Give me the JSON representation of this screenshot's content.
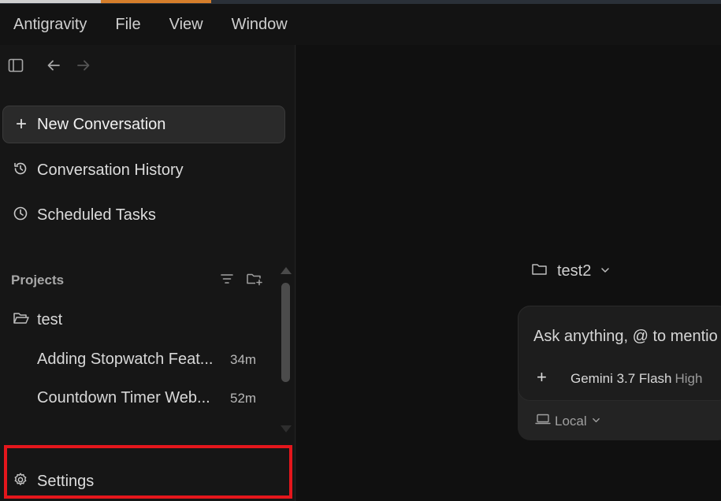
{
  "menubar": {
    "items": [
      "Antigravity",
      "File",
      "View",
      "Window"
    ]
  },
  "sidebar": {
    "new_conversation": "New Conversation",
    "conversation_history": "Conversation History",
    "scheduled_tasks": "Scheduled Tasks",
    "projects_label": "Projects",
    "project": {
      "name": "test",
      "conversations": [
        {
          "title": "Adding Stopwatch Feat...",
          "time": "34m"
        },
        {
          "title": "Countdown Timer Web...",
          "time": "52m"
        }
      ]
    },
    "settings": "Settings"
  },
  "main": {
    "workspace": "test2",
    "input_placeholder": "Ask anything, @ to mentio",
    "model": "Gemini 3.7 Flash",
    "model_level": "High",
    "location": "Local"
  },
  "colors": {
    "highlight": "#e4161c",
    "accent_tab": "#d57e2b"
  }
}
